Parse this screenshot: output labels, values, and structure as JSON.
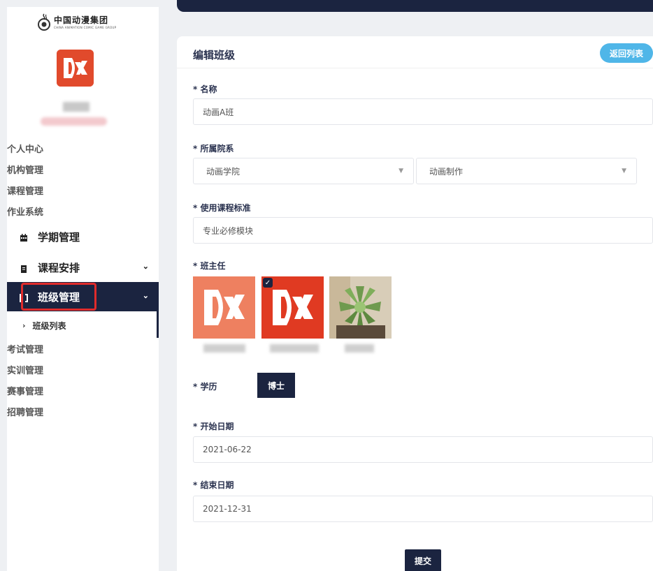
{
  "sidebar": {
    "logo_text": "中国动漫集团",
    "logo_subtext": "CHINA ANIMATION COMIC GAME GROUP",
    "menu": [
      {
        "label": "个人中心"
      },
      {
        "label": "机构管理"
      },
      {
        "label": "课程管理"
      },
      {
        "label": "作业系统"
      }
    ],
    "big_menu": [
      {
        "label": "学期管理"
      },
      {
        "label": "课程安排"
      },
      {
        "label": "班级管理"
      }
    ],
    "submenu_label": "班级列表",
    "menu_bottom": [
      {
        "label": "考试管理"
      },
      {
        "label": "实训管理"
      },
      {
        "label": "赛事管理"
      },
      {
        "label": "招聘管理"
      }
    ],
    "colors": {
      "active_bg": "#1b2440",
      "highlight_box": "#e02b2b",
      "avatar": "#e14a2c"
    }
  },
  "card": {
    "title": "编辑班级",
    "back_button": "返回列表",
    "name_label": "* 名称",
    "name_value": "动画A班",
    "dept_label": "* 所属院系",
    "dept_select_1": "动画学院",
    "dept_select_2": "动画制作",
    "standard_label": "* 使用课程标准",
    "standard_value": "专业必修模块",
    "teacher_label": "* 班主任",
    "degree_label": "* 学历",
    "degree_value": "博士",
    "start_label": "* 开始日期",
    "start_value": "2021-06-22",
    "end_label": "* 结束日期",
    "end_value": "2021-12-31",
    "submit_button": "提交"
  }
}
